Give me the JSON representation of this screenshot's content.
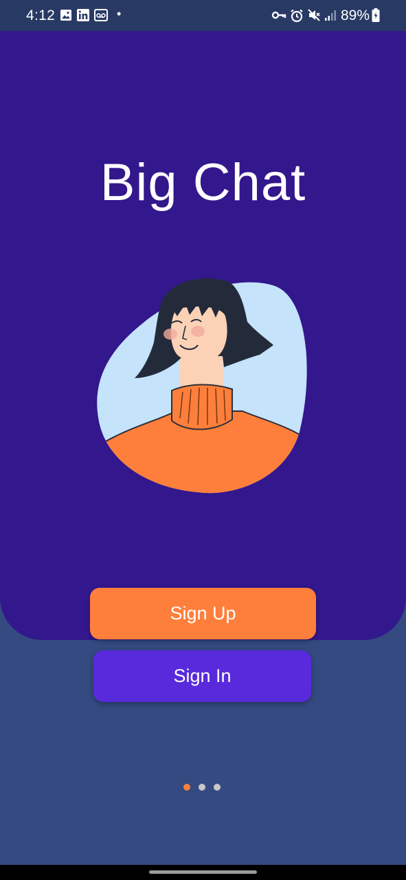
{
  "status_bar": {
    "time": "4:12",
    "left_icons": [
      "image-icon",
      "linkedin-icon",
      "voicemail-icon"
    ],
    "notification_dot": "•",
    "right_icons": [
      "vpn-key-icon",
      "alarm-icon",
      "mute-icon",
      "signal-icon",
      "battery-charging-icon"
    ],
    "battery_percent": "89%"
  },
  "hero": {
    "title": "Big Chat",
    "background_color": "#33178c",
    "illustration": "woman-avatar-illustration"
  },
  "buttons": {
    "sign_up": "Sign Up",
    "sign_in": "Sign In",
    "sign_up_color": "#fe7f3b",
    "sign_in_color": "#5929dc"
  },
  "pager": {
    "count": 3,
    "active_index": 0,
    "active_color": "#fe7f3b",
    "inactive_color": "#c8c8c8"
  },
  "page_background": "#344a80"
}
